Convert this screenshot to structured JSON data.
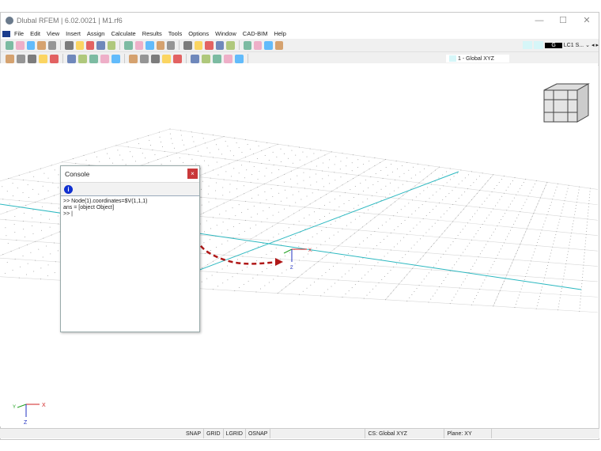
{
  "window": {
    "title": "Dlubal RFEM | 6.02.0021 | M1.rf6",
    "minimize": "—",
    "maximize": "☐",
    "close": "✕"
  },
  "menu": [
    "File",
    "Edit",
    "View",
    "Insert",
    "Assign",
    "Calculate",
    "Results",
    "Tools",
    "Options",
    "Window",
    "CAD-BIM",
    "Help"
  ],
  "toolbar": {
    "load_type": "G",
    "load_case": "LC1",
    "load_case_short": "S...",
    "coord_system": "1 - Global XYZ"
  },
  "console": {
    "title": "Console",
    "close": "×",
    "info_icon": "i",
    "lines": [
      ">> Node(1).coordinates=$V(1,1,1)",
      "ans = [object Object]",
      ">> |"
    ]
  },
  "axes": {
    "x": "X",
    "y": "Y",
    "z": "Z"
  },
  "status": {
    "items": [
      "SNAP",
      "GRID",
      "LGRID",
      "OSNAP"
    ],
    "cs": "CS: Global XYZ",
    "plane": "Plane: XY"
  },
  "colors": {
    "accent": "#2bb8c0",
    "arrow": "#b01818"
  }
}
